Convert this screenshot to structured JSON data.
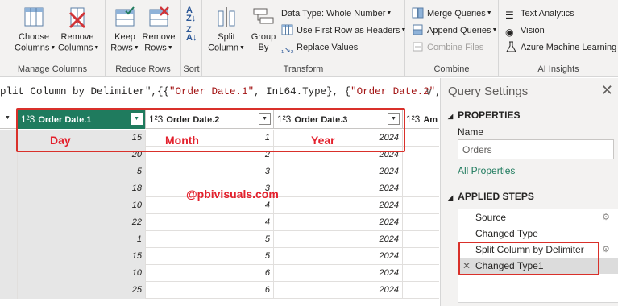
{
  "ribbon": {
    "manage_columns": {
      "group_label": "Manage Columns",
      "choose_columns": [
        "Choose",
        "Columns"
      ],
      "remove_columns": [
        "Remove",
        "Columns"
      ]
    },
    "reduce_rows": {
      "group_label": "Reduce Rows",
      "keep_rows": [
        "Keep",
        "Rows"
      ],
      "remove_rows": [
        "Remove",
        "Rows"
      ]
    },
    "sort": {
      "group_label": "Sort"
    },
    "transform": {
      "group_label": "Transform",
      "split_column": [
        "Split",
        "Column"
      ],
      "group_by": [
        "Group",
        "By"
      ],
      "data_type": "Data Type: Whole Number",
      "use_first_row": "Use First Row as Headers",
      "replace_values": "Replace Values"
    },
    "combine": {
      "group_label": "Combine",
      "merge_queries": "Merge Queries",
      "append_queries": "Append Queries",
      "combine_files": "Combine Files"
    },
    "ai_insights": {
      "group_label": "AI Insights",
      "text_analytics": "Text Analytics",
      "vision": "Vision",
      "azure_ml": "Azure Machine Learning"
    }
  },
  "formula": {
    "prefix": "plit Column by Delimiter\",{{",
    "s1": "\"Order Date.1\"",
    "mid": ", Int64.Type}, {",
    "s2": "\"Order Date.2\"",
    "suffix": ","
  },
  "grid": {
    "type_label": "1²3",
    "headers": [
      "Order Date.1",
      "Order Date.2",
      "Order Date.3",
      "Am"
    ],
    "annotations": [
      "Day",
      "Month",
      "Year"
    ],
    "watermark": "@pbivisuals.com",
    "rows": [
      [
        "15",
        "1",
        "2024"
      ],
      [
        "20",
        "2",
        "2024"
      ],
      [
        "5",
        "3",
        "2024"
      ],
      [
        "18",
        "3",
        "2024"
      ],
      [
        "10",
        "4",
        "2024"
      ],
      [
        "22",
        "4",
        "2024"
      ],
      [
        "1",
        "5",
        "2024"
      ],
      [
        "15",
        "5",
        "2024"
      ],
      [
        "10",
        "6",
        "2024"
      ],
      [
        "25",
        "6",
        "2024"
      ]
    ]
  },
  "query_settings": {
    "title": "Query Settings",
    "properties_label": "PROPERTIES",
    "name_label": "Name",
    "name_value": "Orders",
    "all_properties": "All Properties",
    "applied_steps_label": "APPLIED STEPS",
    "steps": [
      "Source",
      "Changed Type",
      "Split Column by Delimiter",
      "Changed Type1"
    ]
  },
  "colors": {
    "accent": "#1f7b5e",
    "annotation_red": "#e3212d"
  }
}
